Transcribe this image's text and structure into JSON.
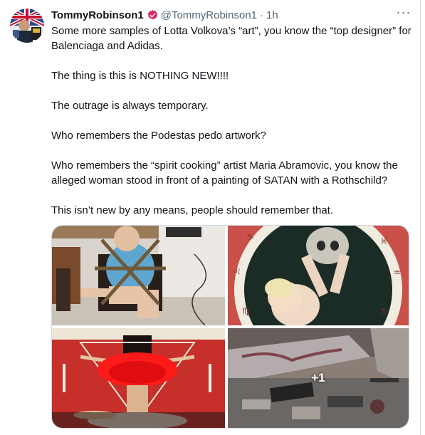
{
  "tweet": {
    "author_name": "TommyRobinson1",
    "handle": "@TommyRobinson1",
    "separator": "·",
    "time": "1h",
    "more_label": "···",
    "paragraphs": [
      "Some more samples of Lotta Volkova’s “art”, you know the “top designer” for Balenciaga and Adidas.",
      "The thing is this is NOTHING NEW!!!!",
      "The outrage is always temporary.",
      "Who remembers the Podestas pedo artwork?",
      "Who remembers the “spirit cooking” artist Maria Abramovic, you know the alleged woman stood in front of a painting of SATAN with a Rothschild?",
      "This isn’t new by any means, people should remember that."
    ]
  },
  "media": {
    "extra_count_label": "+1"
  },
  "colors": {
    "verified_badge": "#e0245e",
    "secondary_text": "#536471",
    "border": "#cfd9de"
  }
}
